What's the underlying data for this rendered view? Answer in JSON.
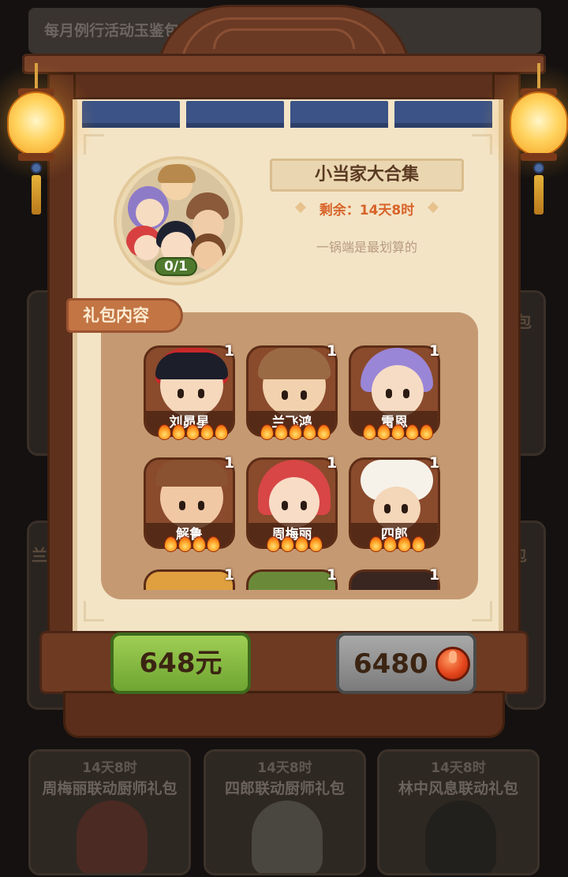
{
  "background": {
    "header_text": "每月例行活动玉鉴包",
    "side_left_1": "厨",
    "side_right_1": "包",
    "side_left_2": "兰飞",
    "side_right_2": "包",
    "cards": [
      {
        "time": "14天8时",
        "name": "周梅丽联动厨师礼包"
      },
      {
        "time": "14天8时",
        "name": "四郎联动厨师礼包"
      },
      {
        "time": "14天8时",
        "name": "林中风息联动礼包"
      }
    ]
  },
  "pack": {
    "title": "小当家大合集",
    "remaining": "剩余：14天8时",
    "slogan": "一锅端是最划算的",
    "owned_count": "0/1",
    "contents_tab": "礼包内容"
  },
  "chefs": [
    {
      "name": "刘昴星",
      "qty": "1",
      "stars": 5
    },
    {
      "name": "兰飞鸿",
      "qty": "1",
      "stars": 5
    },
    {
      "name": "雷恩",
      "qty": "1",
      "stars": 5
    },
    {
      "name": "解鲁",
      "qty": "1",
      "stars": 4
    },
    {
      "name": "周梅丽",
      "qty": "1",
      "stars": 4
    },
    {
      "name": "四郎",
      "qty": "1",
      "stars": 4
    },
    {
      "name": "",
      "qty": "1",
      "stars": 0
    },
    {
      "name": "",
      "qty": "1",
      "stars": 0
    },
    {
      "name": "",
      "qty": "1",
      "stars": 0
    }
  ],
  "buttons": {
    "cash_price": "648元",
    "coin_price": "6480"
  },
  "colors": {
    "wood": "#6b3a24",
    "parchment": "#f3e4c6",
    "accent_orange": "#d8642a",
    "button_green": "#8cc048",
    "button_grey": "#959595"
  }
}
